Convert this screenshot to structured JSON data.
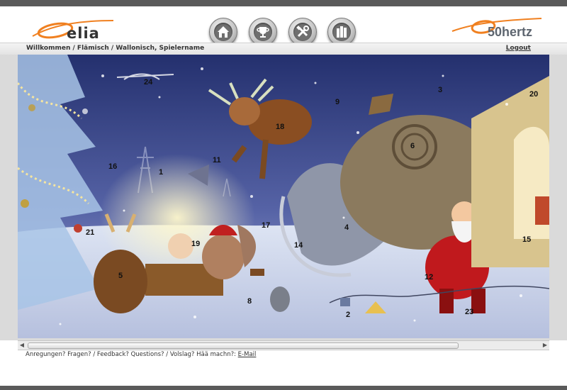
{
  "header": {
    "logo_left_text": "elia",
    "logo_right_text": "50hertz",
    "nav_buttons": [
      "home-icon",
      "trophy-icon",
      "tools-icon",
      "books-icon"
    ]
  },
  "subnav": {
    "breadcrumb": "Willkommen / Flämisch / Wallonisch, Spielername",
    "logout": "Logout"
  },
  "scene": {
    "days": [
      "24",
      "20",
      "3",
      "9",
      "18",
      "6",
      "16",
      "1",
      "11",
      "21",
      "19",
      "17",
      "4",
      "14",
      "15",
      "5",
      "12",
      "8",
      "2",
      "23"
    ]
  },
  "footer": {
    "text": "Anregungen? Fragen? / Feedback? Questions? / Volslag? Hää machn?:",
    "email": "E-Mail"
  },
  "colors": {
    "accent_orange": "#f08020",
    "top_bar": "#5a5a5a",
    "sky_dark": "#2a3377",
    "snow": "#e9edf6"
  }
}
